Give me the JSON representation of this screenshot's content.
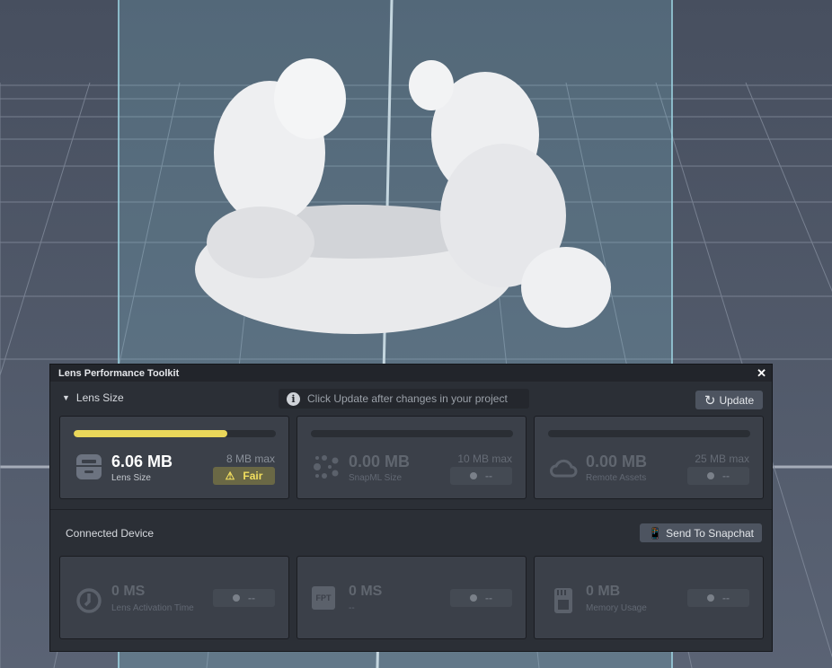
{
  "panel": {
    "title": "Lens Performance Toolkit",
    "close": "✕"
  },
  "lens_size": {
    "section_title": "Lens Size",
    "info_text": "Click Update after changes in your project",
    "update_label": "Update",
    "cards": [
      {
        "value": "6.06 MB",
        "label": "Lens Size",
        "max": "8 MB max",
        "status": "Fair",
        "progress": 0.76,
        "icon": "archive-icon"
      },
      {
        "value": "0.00 MB",
        "label": "SnapML Size",
        "max": "10 MB max",
        "status": "--",
        "progress": 0,
        "icon": "network-icon"
      },
      {
        "value": "0.00 MB",
        "label": "Remote Assets",
        "max": "25 MB max",
        "status": "--",
        "progress": 0,
        "icon": "cloud-icon"
      }
    ]
  },
  "device": {
    "section_title": "Connected Device",
    "send_label": "Send To Snapchat",
    "cards": [
      {
        "value": "0 MS",
        "label": "Lens Activation Time",
        "status": "--",
        "icon": "clock-icon"
      },
      {
        "value": "0 MS",
        "label": "--",
        "status": "--",
        "icon": "fpt-icon",
        "icon_text": "FPT"
      },
      {
        "value": "0 MB",
        "label": "Memory Usage",
        "status": "--",
        "icon": "sd-card-icon"
      }
    ]
  },
  "colors": {
    "accent": "#ead75a",
    "panel": "#2b2f36",
    "card": "#3b4049"
  }
}
